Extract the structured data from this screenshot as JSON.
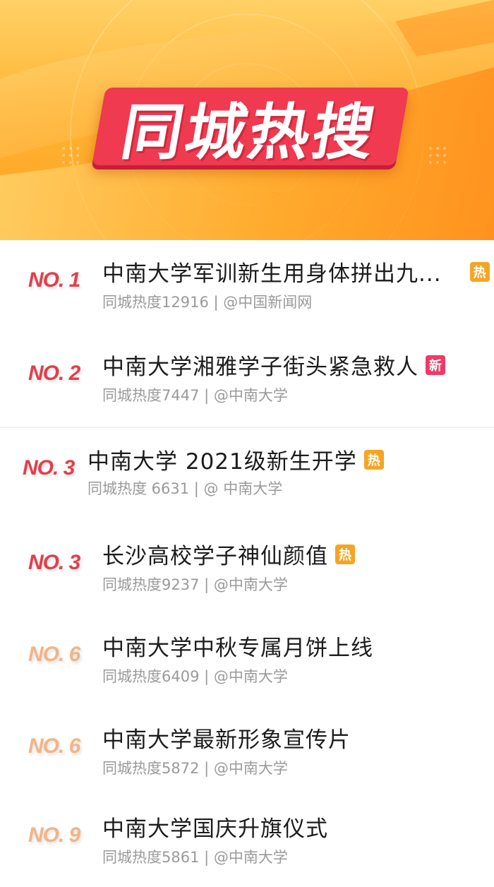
{
  "banner": {
    "title": "同城热搜",
    "colors": {
      "background": "#ffb535",
      "title_bg": "#ef3a50"
    }
  },
  "items": [
    {
      "rank": "NO. 1",
      "title": "中南大学军训新生用身体拼出九...",
      "tag": "热",
      "tag_type": "hot",
      "meta": "同城热度12916 | @中国新闻网"
    },
    {
      "rank": "NO. 2",
      "title": "中南大学湘雅学子街头紧急救人",
      "tag": "新",
      "tag_type": "new",
      "meta": "同城热度7447 | @中南大学"
    },
    {
      "rank": "NO. 3",
      "title": "中南大学 2021级新生开学",
      "tag": "热",
      "tag_type": "hot",
      "meta": "同城热度 6631 | @ 中南大学"
    },
    {
      "rank": "NO. 3",
      "title": "长沙高校学子神仙颜值",
      "tag": "热",
      "tag_type": "hot",
      "meta": "同城热度9237 | @中南大学"
    },
    {
      "rank": "NO. 6",
      "title": "中南大学中秋专属月饼上线",
      "tag": "",
      "tag_type": "",
      "meta": "同城热度6409 | @中南大学"
    },
    {
      "rank": "NO. 6",
      "title": "中南大学最新形象宣传片",
      "tag": "",
      "tag_type": "",
      "meta": "同城热度5872 | @中南大学"
    },
    {
      "rank": "NO. 9",
      "title": "中南大学国庆升旗仪式",
      "tag": "",
      "tag_type": "",
      "meta": "同城热度5861 | @中南大学"
    }
  ],
  "colors": {
    "rank_red": "#e0404c",
    "rank_faint": "#f2b486",
    "tag_hot": "#f5a523",
    "tag_new": "#ef3a66",
    "meta_text": "#9a9a9a"
  }
}
